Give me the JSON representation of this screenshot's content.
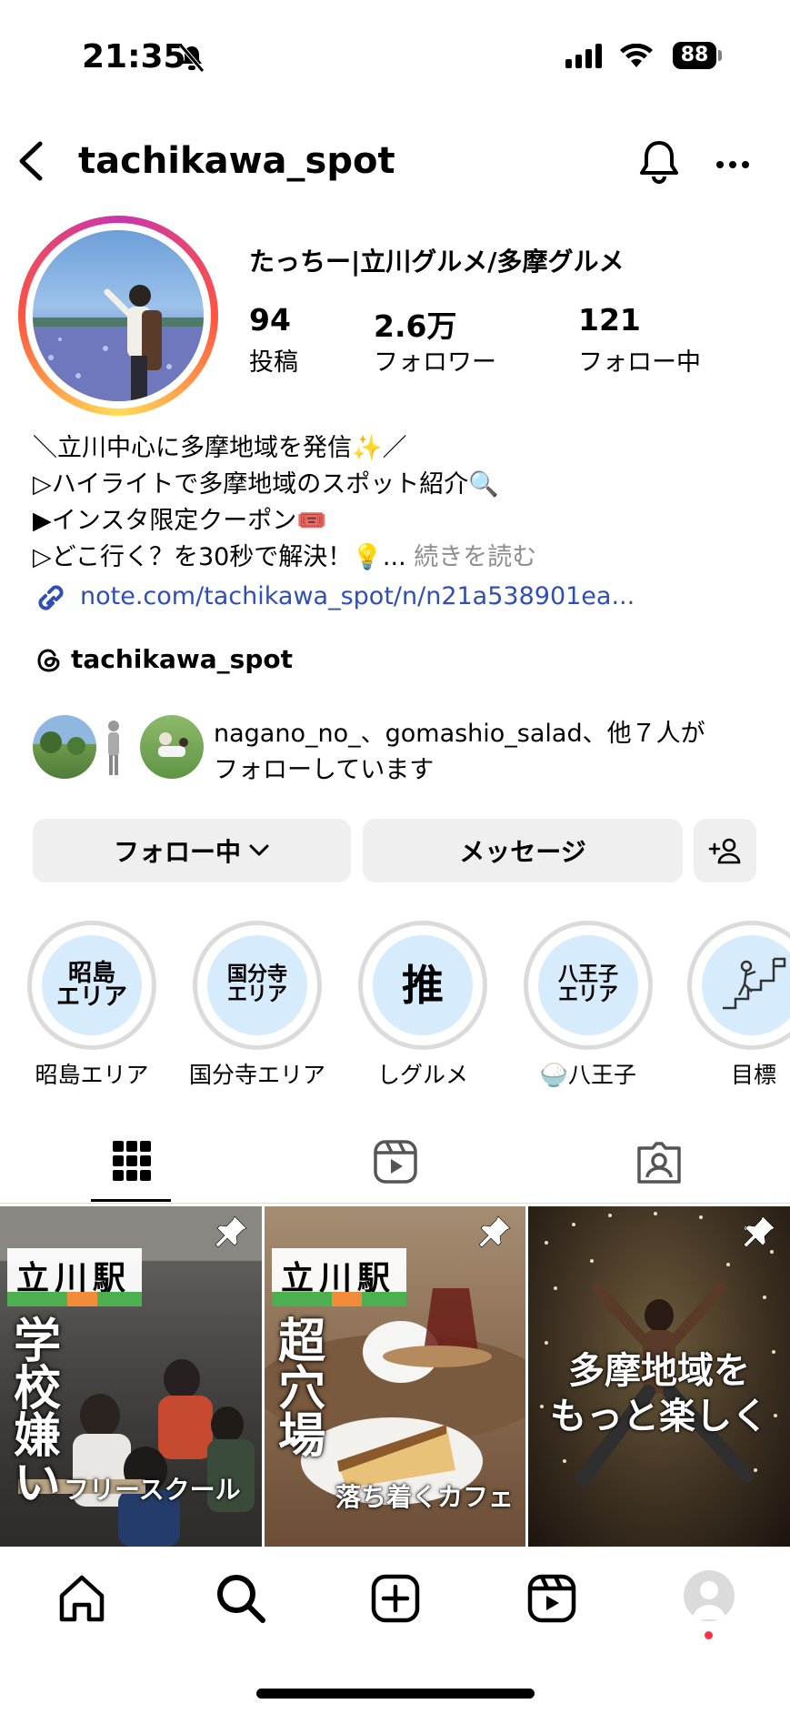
{
  "status_bar": {
    "time": "21:35",
    "battery": "88"
  },
  "header": {
    "username": "tachikawa_spot"
  },
  "profile": {
    "display_name": "たっちー|立川グルメ/多摩グルメ",
    "stats": [
      {
        "value": "94",
        "label": "投稿"
      },
      {
        "value": "2.6万",
        "label": "フォロワー"
      },
      {
        "value": "121",
        "label": "フォロー中"
      }
    ],
    "bio": [
      "＼立川中心に多摩地域を発信✨／",
      "▷ハイライトで多摩地域のスポット紹介🔍",
      "▶インスタ限定クーポン🎟️",
      "▷どこ行く？を30秒で解決！💡..."
    ],
    "bio_more": "続きを読む",
    "link": "note.com/tachikawa_spot/n/n21a538901ea...",
    "threads_handle": "tachikawa_spot",
    "mutual_line1": "nagano_no_、gomashio_salad、他７人が",
    "mutual_line2": "フォローしています"
  },
  "actions": {
    "following_label": "フォロー中",
    "message_label": "メッセージ"
  },
  "highlights": [
    {
      "cover_text": "昭島\nエリア",
      "label": "昭島エリア"
    },
    {
      "cover_text": "国分寺\nエリア",
      "label": "国分寺エリア"
    },
    {
      "cover_text": "推",
      "label": "しグルメ"
    },
    {
      "cover_text": "八王子\nエリア",
      "label": "🍚八王子"
    },
    {
      "cover_text": "",
      "label": "目標"
    }
  ],
  "posts": [
    {
      "station": "立川駅",
      "vertical": "学校嫌い",
      "sub": "フリースクール"
    },
    {
      "station": "立川駅",
      "vertical": "超穴場",
      "sub": "落ち着くカフェ"
    },
    {
      "line1": "多摩地域を",
      "line2": "もっと楽しく"
    }
  ],
  "colors": {
    "link": "#2f4eb8",
    "button_bg": "#efefef",
    "highlight_bg": "#d6ebfb",
    "notification": "#ff3040"
  },
  "icons": [
    "back-icon",
    "bell-icon",
    "more-icon",
    "link-icon",
    "threads-icon",
    "chevron-down-icon",
    "add-person-icon",
    "grid-icon",
    "reels-icon",
    "tagged-icon",
    "pin-icon",
    "home-icon",
    "search-icon",
    "create-icon",
    "reels-nav-icon",
    "profile-icon"
  ]
}
